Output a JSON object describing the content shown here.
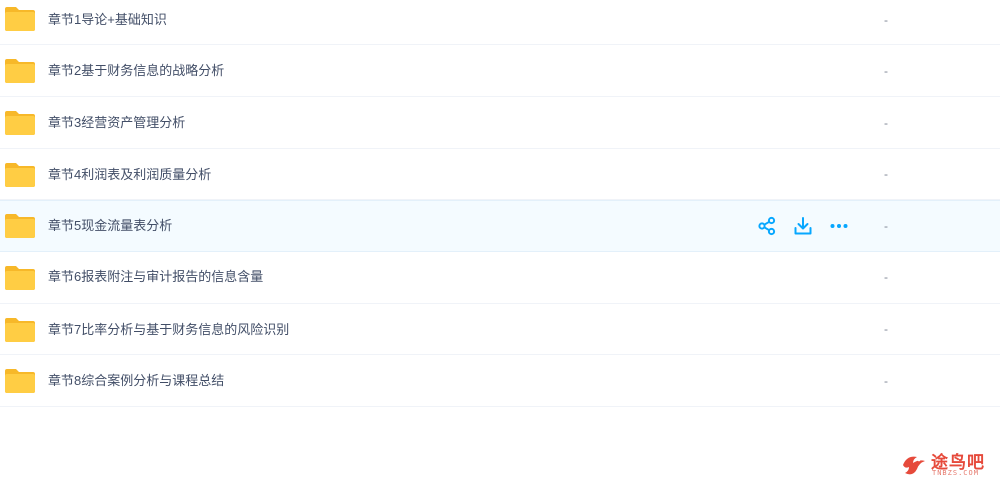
{
  "files": [
    {
      "name": "章节1导论+基础知识",
      "size": "-"
    },
    {
      "name": "章节2基于财务信息的战略分析",
      "size": "-"
    },
    {
      "name": "章节3经营资产管理分析",
      "size": "-"
    },
    {
      "name": "章节4利润表及利润质量分析",
      "size": "-"
    },
    {
      "name": "章节5现金流量表分析",
      "size": "-"
    },
    {
      "name": "章节6报表附注与审计报告的信息含量",
      "size": "-"
    },
    {
      "name": "章节7比率分析与基于财务信息的风险识别",
      "size": "-"
    },
    {
      "name": "章节8综合案例分析与课程总结",
      "size": "-"
    }
  ],
  "hovered_row_index": 4,
  "row_actions": [
    "share-icon",
    "download-icon",
    "more-icon"
  ],
  "watermark": {
    "title": "途鸟吧",
    "subtitle": "TNBZS.COM"
  },
  "colors": {
    "folder": "#ffcd44",
    "folder_dark": "#f7b829",
    "accent": "#06a7ff",
    "text": "#424e67",
    "hover_bg": "#f4fbff"
  }
}
